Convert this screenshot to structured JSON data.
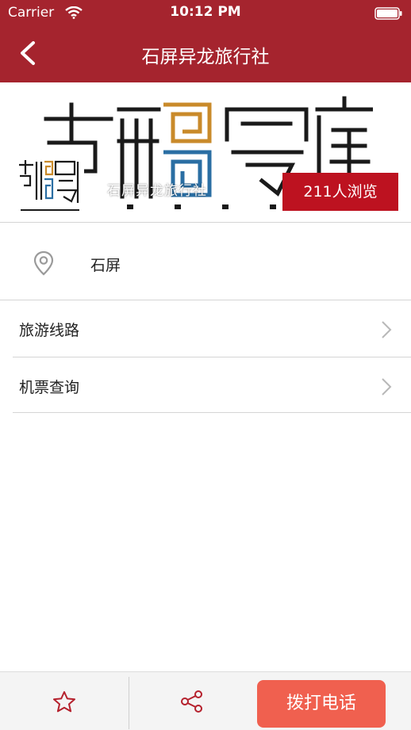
{
  "status_bar": {
    "carrier": "Carrier",
    "time": "10:12 PM"
  },
  "nav": {
    "title": "石屏异龙旅行社"
  },
  "banner": {
    "agency_name": "石屏异龙旅行社",
    "views": "211人浏览"
  },
  "location": {
    "text": "石屏"
  },
  "menu": [
    {
      "label": "旅游线路"
    },
    {
      "label": "机票查询"
    }
  ],
  "bottom_bar": {
    "call_label": "拨打电话"
  },
  "colors": {
    "brand": "#a5242e",
    "badge": "#bd1220",
    "call_button": "#f0604f"
  }
}
